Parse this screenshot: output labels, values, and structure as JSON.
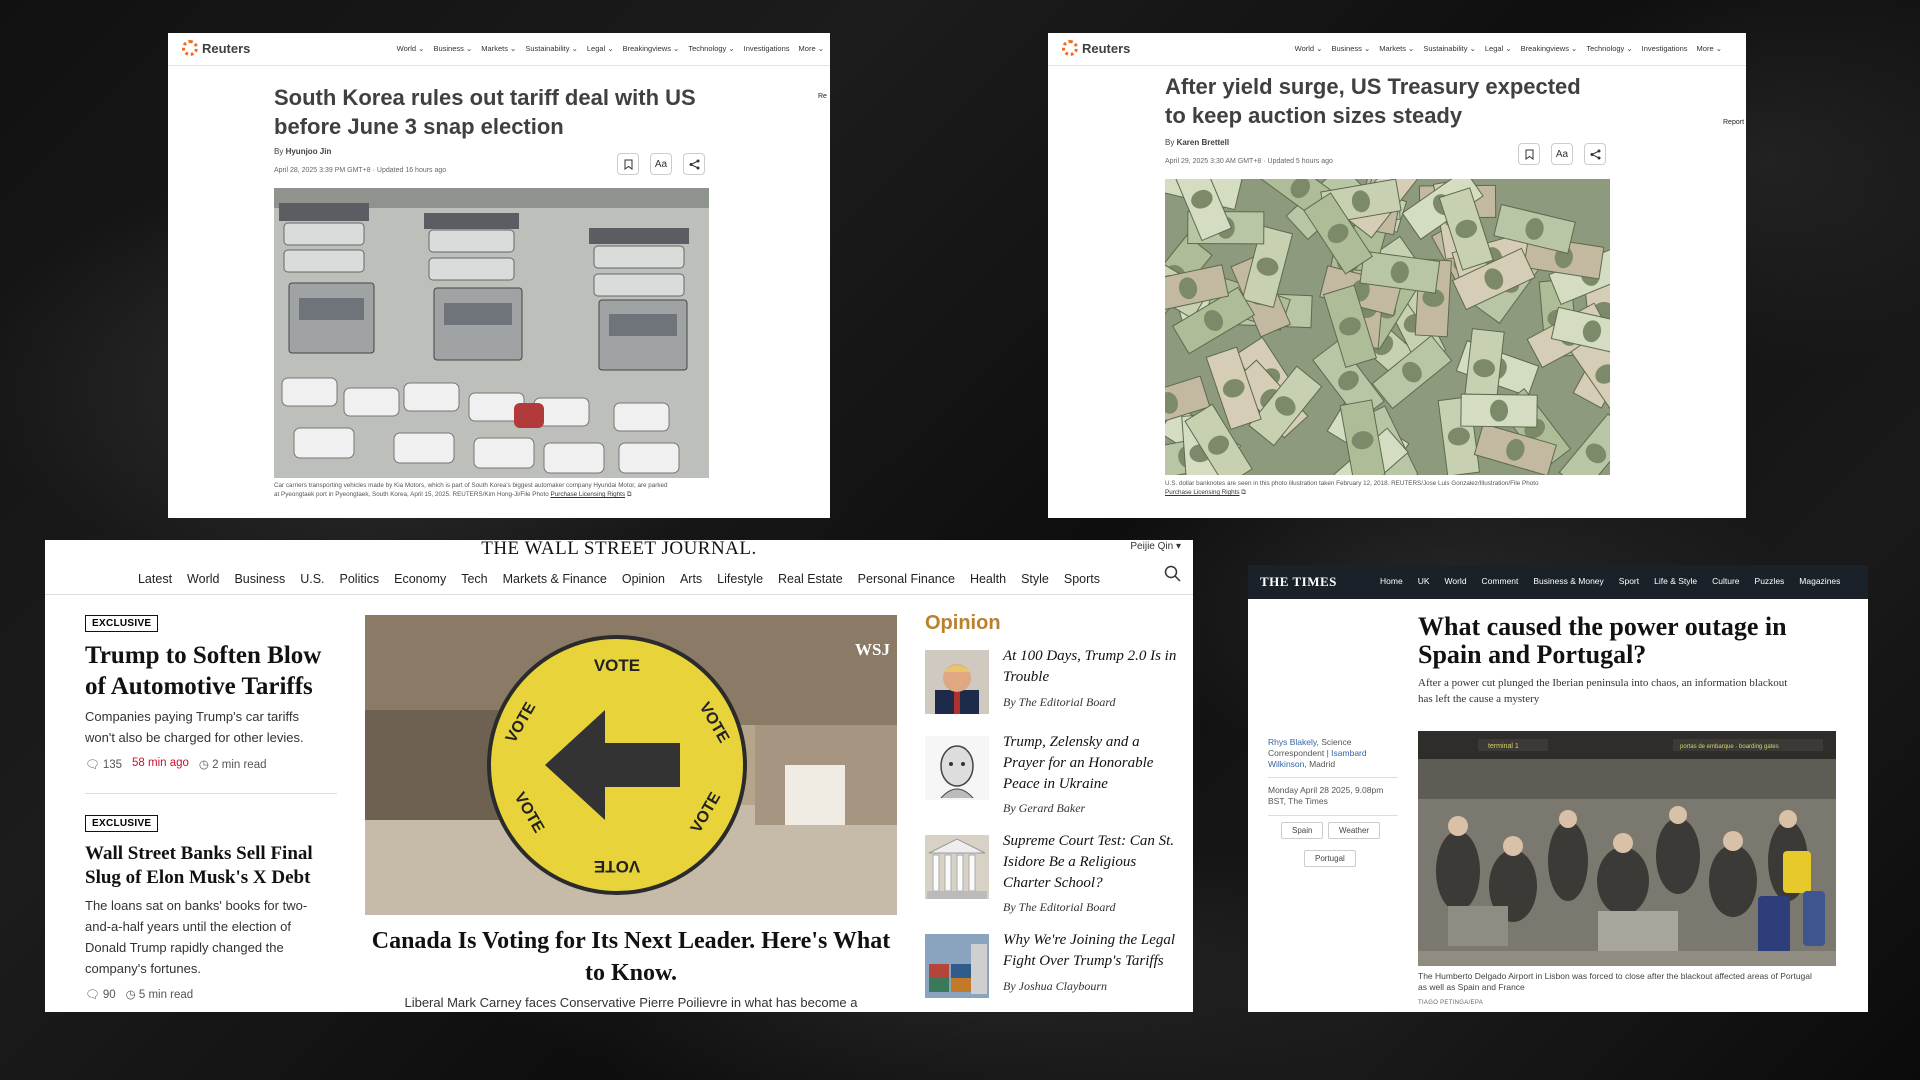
{
  "reuters1": {
    "logo": "Reuters",
    "nav": [
      "World ⌄",
      "Business ⌄",
      "Markets ⌄",
      "Sustainability ⌄",
      "Legal ⌄",
      "Breakingviews ⌄",
      "Technology ⌄",
      "Investigations",
      "More ⌄"
    ],
    "title_line1": "South Korea rules out tariff deal with US",
    "title_line2": "before June 3 snap election",
    "by_prefix": "By",
    "author": "Hyunjoo Jin",
    "date": "April 28, 2025 3:39 PM GMT+8 · Updated 16 hours ago",
    "btn_text": "Aa",
    "side_text": "Re",
    "caption_line1": "Car carriers transporting vehicles made by Kia Motors, which is part of South Korea's biggest automaker company Hyundai Motor, are parked",
    "caption_line2": "at Pyeongtaek port in Pyeongtaek, South Korea, April 15, 2025. REUTERS/Kim Hong-Ji/File Photo",
    "caption_link": "Purchase Licensing Rights"
  },
  "reuters2": {
    "logo": "Reuters",
    "nav": [
      "World ⌄",
      "Business ⌄",
      "Markets ⌄",
      "Sustainability ⌄",
      "Legal ⌄",
      "Breakingviews ⌄",
      "Technology ⌄",
      "Investigations",
      "More ⌄"
    ],
    "title_line1": "After yield surge, US Treasury expected",
    "title_line2": "to keep auction sizes steady",
    "by_prefix": "By",
    "author": "Karen Brettell",
    "date": "April 29, 2025 3:30 AM GMT+8 · Updated 5 hours ago",
    "btn_text": "Aa",
    "side_text": "Report",
    "caption_line1": "U.S. dollar banknotes are seen in this photo illustration taken February 12, 2018. REUTERS/Jose Luis Gonzalez/Illustration/File Photo",
    "caption_link": "Purchase Licensing Rights"
  },
  "wsj": {
    "logo": "THE WALL STREET JOURNAL.",
    "user": "Peijie Qin ▾",
    "nav": [
      "Latest",
      "World",
      "Business",
      "U.S.",
      "Politics",
      "Economy",
      "Tech",
      "Markets & Finance",
      "Opinion",
      "Arts",
      "Lifestyle",
      "Real Estate",
      "Personal Finance",
      "Health",
      "Style",
      "Sports"
    ],
    "story1": {
      "badge": "EXCLUSIVE",
      "h1": "Trump to Soften Blow",
      "h2": "of Automotive Tariffs",
      "p1": "Companies paying Trump's car tariffs",
      "p2": "won't also be charged for other levies.",
      "comments": "135",
      "time": "58 min ago",
      "read": "2 min read"
    },
    "story2": {
      "badge": "EXCLUSIVE",
      "h1": "Wall Street Banks Sell Final",
      "h2": "Slug of Elon Musk's X Debt",
      "p1": "The loans sat on banks' books for two-",
      "p2": "and-a-half years until the election of",
      "p3": "Donald Trump rapidly changed the",
      "p4": "company's fortunes.",
      "comments": "90",
      "read": "5 min read"
    },
    "main": {
      "h1": "Canada Is Voting for Its Next Leader. Here's What",
      "h2": "to Know.",
      "p1": "Liberal Mark Carney faces Conservative Pierre Poilievre in what has become a",
      "watermark": "WSJ",
      "vote": "VOTE"
    },
    "opinion_label": "Opinion",
    "opinion": [
      {
        "l1": "At 100 Days, Trump 2.0 Is in",
        "l2": "Trouble",
        "by": "By The Editorial Board"
      },
      {
        "l1": "Trump, Zelensky and a",
        "l2": "Prayer for an Honorable",
        "l3": "Peace in Ukraine",
        "by": "By Gerard Baker"
      },
      {
        "l1": "Supreme Court Test: Can St.",
        "l2": "Isidore Be a Religious",
        "l3": "Charter School?",
        "by": "By The Editorial Board"
      },
      {
        "l1": "Why We're Joining the Legal",
        "l2": "Fight Over Trump's Tariffs",
        "by": "By Joshua Claybourn"
      }
    ]
  },
  "times": {
    "logo": "THE  TIMES",
    "nav": [
      "Home",
      "UK",
      "World",
      "Comment",
      "Business & Money",
      "Sport",
      "Life & Style",
      "Culture",
      "Puzzles",
      "Magazines"
    ],
    "title_line1": "What caused the power outage in",
    "title_line2": "Spain and Portugal?",
    "sub_line1": "After a power cut plunged the Iberian peninsula into chaos, an information blackout",
    "sub_line2": "has left the cause a mystery",
    "author1": "Rhys Blakely",
    "author1_role": ", Science",
    "author_role2": "Correspondent | ",
    "author2a": "Isambard",
    "author2b": "Wilkinson",
    "author2_loc": ", Madrid",
    "date1": "Monday April 28 2025, 9.08pm",
    "date2": "BST, The Times",
    "tags": [
      "Spain",
      "Weather",
      "Portugal"
    ],
    "caption_line1": "The Humberto Delgado Airport in Lisbon was forced to close after the blackout affected areas of Portugal",
    "caption_line2": "as well as Spain and France",
    "credit": "TIAGO PETINGA/EPA",
    "sign1": "terminal 1",
    "sign2": "portas de embarque · boarding gates"
  }
}
